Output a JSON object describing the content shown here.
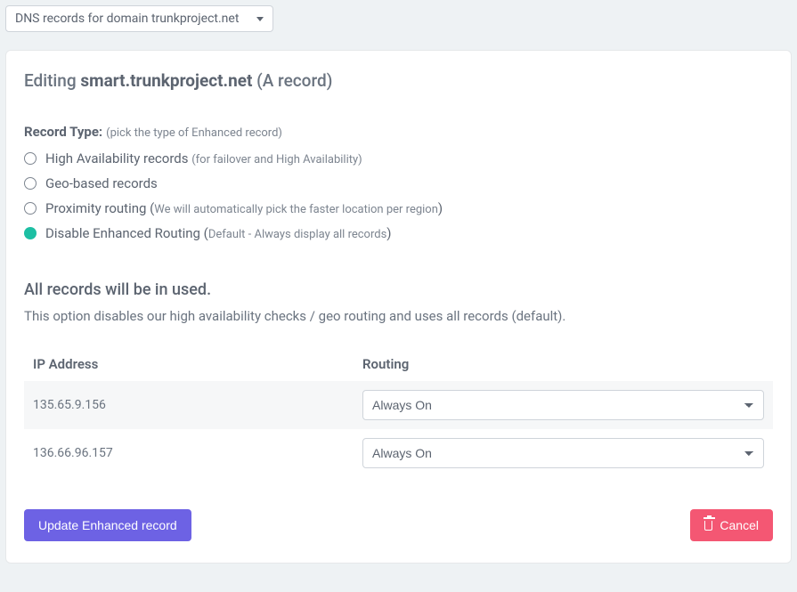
{
  "domain_dropdown": {
    "label": "DNS records for domain trunkproject.net"
  },
  "heading": {
    "prefix": "Editing ",
    "domain": "smart.trunkproject.net",
    "suffix": " (A record)"
  },
  "record_type": {
    "label": "Record Type:",
    "hint": "(pick the type of Enhanced record)",
    "options": [
      {
        "key": "ha",
        "label": "High Availability records ",
        "sub": "(for failover and High Availability)",
        "selected": false
      },
      {
        "key": "geo",
        "label": "Geo-based records",
        "sub": "",
        "selected": false
      },
      {
        "key": "proximity",
        "label": "Proximity routing (",
        "sub": "We will automatically pick the faster location per region",
        "tail": ")",
        "selected": false
      },
      {
        "key": "disable",
        "label": "Disable Enhanced Routing (",
        "sub": "Default - Always display all records",
        "tail": ")",
        "selected": true
      }
    ]
  },
  "section": {
    "title": "All records will be in used.",
    "desc": "This option disables our high availability checks / geo routing and uses all records (default)."
  },
  "table": {
    "headers": {
      "ip": "IP Address",
      "routing": "Routing"
    },
    "rows": [
      {
        "ip": "135.65.9.156",
        "routing": "Always On"
      },
      {
        "ip": "136.66.96.157",
        "routing": "Always On"
      }
    ]
  },
  "buttons": {
    "update": "Update Enhanced record",
    "cancel": "Cancel"
  }
}
